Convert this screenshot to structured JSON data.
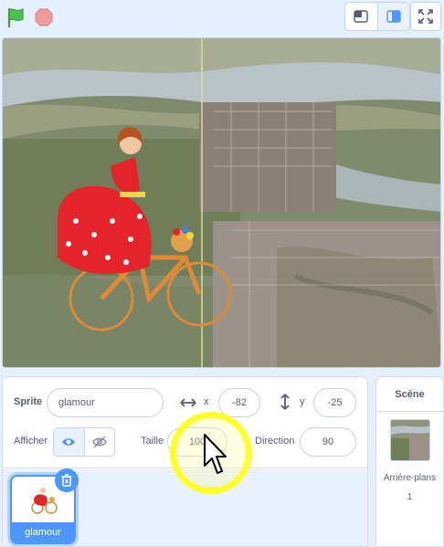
{
  "toolbar": {
    "green_flag_icon": "green-flag-icon",
    "stop_icon": "stop-icon",
    "small_stage_icon": "small-stage-icon",
    "large_stage_icon": "large-stage-icon",
    "fullscreen_icon": "fullscreen-icon"
  },
  "sprite_info": {
    "sprite_label": "Sprite",
    "sprite_name": "glamour",
    "x_label": "x",
    "x_value": "-82",
    "y_label": "y",
    "y_value": "-25",
    "show_label": "Afficher",
    "size_label": "Taille",
    "size_value": "100",
    "direction_label": "Direction",
    "direction_value": "90"
  },
  "sprites": [
    {
      "name": "glamour",
      "selected": true
    }
  ],
  "stage_panel": {
    "title": "Scène",
    "backdrops_label": "Arrière-plans",
    "backdrops_count": "1"
  },
  "colors": {
    "accent": "#4c97ff",
    "background": "#e5f0ff",
    "text": "#575e75",
    "cursor_highlight": "#ffff2a"
  }
}
